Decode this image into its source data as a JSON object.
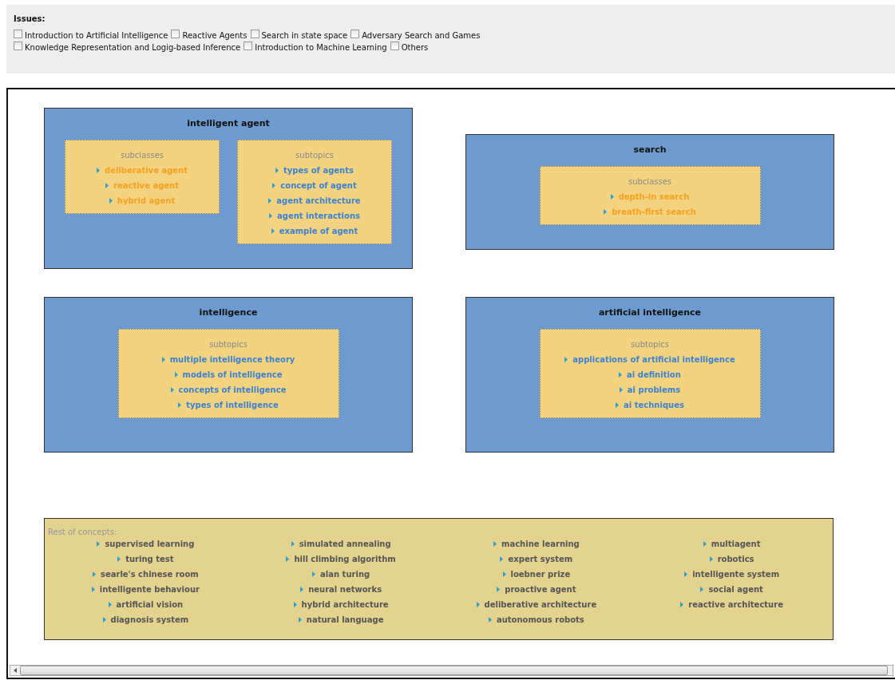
{
  "issues": {
    "title": "Issues:",
    "options": [
      {
        "label": "Introduction to Artificial Intelligence",
        "checked": false
      },
      {
        "label": "Reactive Agents",
        "checked": false
      },
      {
        "label": "Search in state space",
        "checked": false
      },
      {
        "label": "Adversary Search and Games",
        "checked": false
      },
      {
        "label": "Knowledge Representation and Logig-based Inference",
        "checked": false
      },
      {
        "label": "Introduction to Machine Learning",
        "checked": false
      },
      {
        "label": "Others",
        "checked": false
      }
    ]
  },
  "concepts": [
    {
      "title": "intelligent agent",
      "groups": [
        {
          "kind": "subclasses",
          "heading": "subclasses",
          "items": [
            "deliberative agent",
            "reactive agent",
            "hybrid agent"
          ]
        },
        {
          "kind": "subtopics",
          "heading": "subtopics",
          "items": [
            "types of agents",
            "concept of agent",
            "agent architecture",
            "agent interactions",
            "example of agent"
          ]
        }
      ]
    },
    {
      "title": "search",
      "groups": [
        {
          "kind": "subclasses",
          "heading": "subclasses",
          "items": [
            "depth-in search",
            "breath-first search"
          ]
        }
      ]
    },
    {
      "title": "intelligence",
      "groups": [
        {
          "kind": "subtopics",
          "heading": "subtopics",
          "items": [
            "multiple intelligence theory",
            "models of intelligence",
            "concepts of intelligence",
            "types of intelligence"
          ]
        }
      ]
    },
    {
      "title": "artificial intelligence",
      "groups": [
        {
          "kind": "subtopics",
          "heading": "subtopics",
          "items": [
            "applications of artificial intelligence",
            "ai definition",
            "ai problems",
            "ai techniques"
          ]
        }
      ]
    }
  ],
  "rest": {
    "heading": "Rest of concepts:",
    "columns": [
      [
        "supervised learning",
        "turing test",
        "searle's chinese room",
        "intelligente behaviour",
        "artificial vision",
        "diagnosis system"
      ],
      [
        "simulated annealing",
        "hill climbing algorithm",
        "alan turing",
        "neural networks",
        "hybrid architecture",
        "natural language"
      ],
      [
        "machine learning",
        "expert system",
        "loebner prize",
        "proactive agent",
        "deliberative architecture",
        "autonomous robots"
      ],
      [
        "multiagent",
        "robotics",
        "intelligente system",
        "social agent",
        "reactive architecture"
      ]
    ]
  }
}
